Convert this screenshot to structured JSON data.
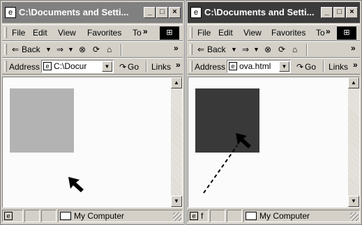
{
  "colors": {
    "window_face": "#d4d0c8",
    "inactive_title": "#808080",
    "active_title": "#3b3b3b",
    "light_square": "#b3b3b3",
    "dark_square": "#393939"
  },
  "windows": [
    {
      "title": "C:\\Documents and Setti...",
      "title_buttons": [
        "_",
        "□",
        "×"
      ],
      "menu": [
        "File",
        "Edit",
        "View",
        "Favorites",
        "To"
      ],
      "menu_overflow": "»",
      "nav": {
        "back": "Back",
        "overflow": "»"
      },
      "address_label": "Address",
      "address_value": "C:\\Docur",
      "go_label": "Go",
      "links_label": "Links",
      "links_overflow": "»",
      "status_left": "",
      "status_zone": "My Computer",
      "square_color": "#b3b3b3"
    },
    {
      "title": "C:\\Documents and Setti...",
      "title_buttons": [
        "_",
        "□",
        "×"
      ],
      "menu": [
        "File",
        "Edit",
        "View",
        "Favorites",
        "To"
      ],
      "menu_overflow": "»",
      "nav": {
        "back": "Back",
        "overflow": "»"
      },
      "address_label": "Address",
      "address_value": "ova.html",
      "go_label": "Go",
      "links_label": "Links",
      "links_overflow": "»",
      "status_left": "f",
      "status_zone": "My Computer",
      "square_color": "#393939"
    }
  ],
  "icons": [
    "ie-page-icon",
    "windows-logo-icon",
    "back-arrow-icon",
    "forward-arrow-icon",
    "stop-icon",
    "refresh-icon",
    "home-icon",
    "go-arrow-icon",
    "scroll-up-icon",
    "scroll-down-icon",
    "my-computer-icon",
    "mouse-cursor-icon",
    "dashed-trajectory"
  ]
}
